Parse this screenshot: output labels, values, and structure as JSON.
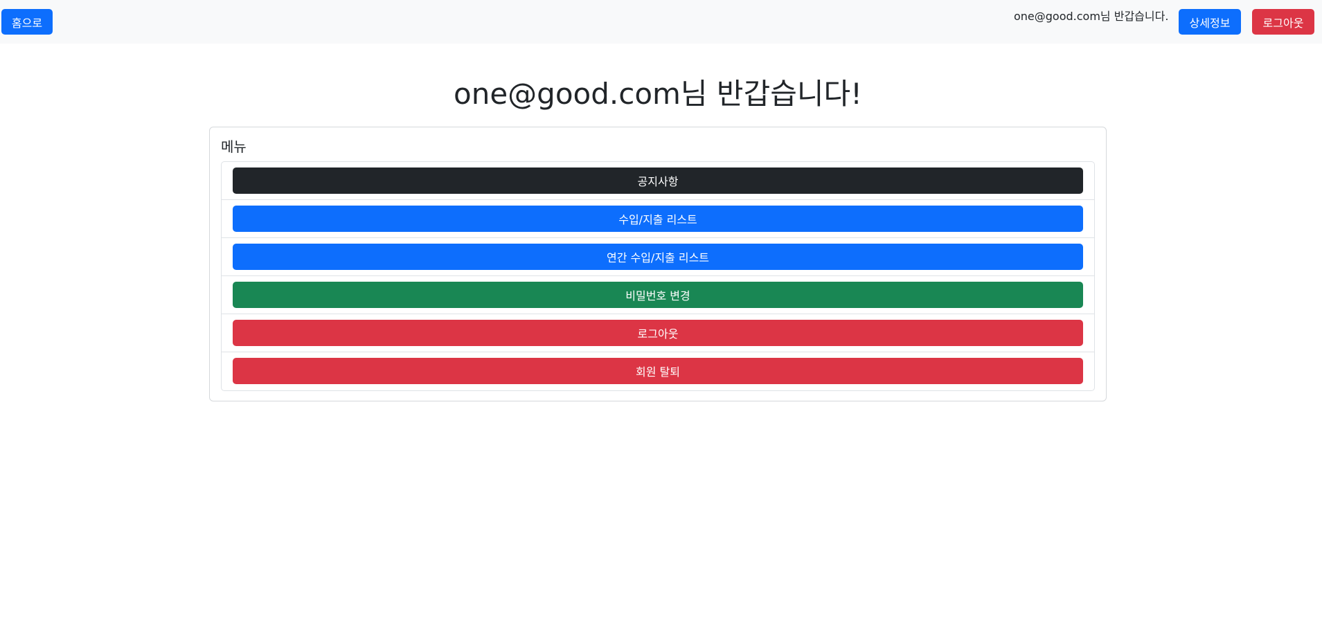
{
  "navbar": {
    "home_label": "홈으로",
    "welcome_text": "one@good.com님 반갑습니다.",
    "detail_label": "상세정보",
    "logout_label": "로그아웃"
  },
  "main": {
    "title": "one@good.com님 반갑습니다!",
    "menu_label": "메뉴",
    "menu_items": [
      {
        "label": "공지사항",
        "color": "#212529"
      },
      {
        "label": "수입/지출 리스트",
        "color": "#0d6efd"
      },
      {
        "label": "연간 수입/지출 리스트",
        "color": "#0d6efd"
      },
      {
        "label": "비밀번호 변경",
        "color": "#198754"
      },
      {
        "label": "로그아웃",
        "color": "#dc3545"
      },
      {
        "label": "회원 탈퇴",
        "color": "#dc3545"
      }
    ]
  },
  "colors": {
    "primary": "#0d6efd",
    "danger": "#dc3545",
    "dark": "#212529",
    "success": "#198754",
    "navbar_bg": "#f8f9fa"
  }
}
